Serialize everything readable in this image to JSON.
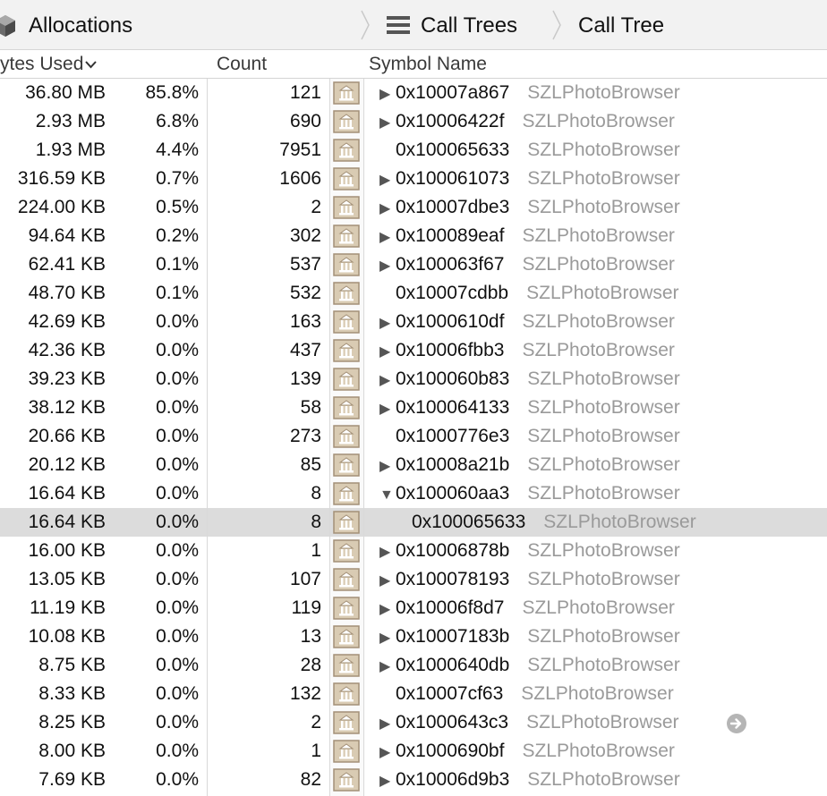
{
  "toolbar": {
    "allocations_label": "Allocations",
    "call_trees_label": "Call Trees",
    "call_tree_label": "Call Tree"
  },
  "columns": {
    "bytes_used": "ytes Used",
    "count": "Count",
    "symbol_name": "Symbol Name"
  },
  "colors": {
    "library_text": "#9a9a9a",
    "selected_row": "#dcdcdc",
    "library_icon_frame": "#a39077",
    "library_icon_fill": "#d9cbb3"
  },
  "rows": [
    {
      "bytes": "36.80 MB",
      "pct": "85.8%",
      "count": "121",
      "disclosure": "collapsed",
      "symbol": "0x10007a867",
      "library": "SZLPhotoBrowser"
    },
    {
      "bytes": "2.93 MB",
      "pct": "6.8%",
      "count": "690",
      "disclosure": "collapsed",
      "symbol": "0x10006422f",
      "library": "SZLPhotoBrowser"
    },
    {
      "bytes": "1.93 MB",
      "pct": "4.4%",
      "count": "7951",
      "disclosure": "none",
      "symbol": "0x100065633",
      "library": "SZLPhotoBrowser"
    },
    {
      "bytes": "316.59 KB",
      "pct": "0.7%",
      "count": "1606",
      "disclosure": "collapsed",
      "symbol": "0x100061073",
      "library": "SZLPhotoBrowser"
    },
    {
      "bytes": "224.00 KB",
      "pct": "0.5%",
      "count": "2",
      "disclosure": "collapsed",
      "symbol": "0x10007dbe3",
      "library": "SZLPhotoBrowser"
    },
    {
      "bytes": "94.64 KB",
      "pct": "0.2%",
      "count": "302",
      "disclosure": "collapsed",
      "symbol": "0x100089eaf",
      "library": "SZLPhotoBrowser"
    },
    {
      "bytes": "62.41 KB",
      "pct": "0.1%",
      "count": "537",
      "disclosure": "collapsed",
      "symbol": "0x100063f67",
      "library": "SZLPhotoBrowser"
    },
    {
      "bytes": "48.70 KB",
      "pct": "0.1%",
      "count": "532",
      "disclosure": "none",
      "symbol": "0x10007cdbb",
      "library": "SZLPhotoBrowser"
    },
    {
      "bytes": "42.69 KB",
      "pct": "0.0%",
      "count": "163",
      "disclosure": "collapsed",
      "symbol": "0x1000610df",
      "library": "SZLPhotoBrowser"
    },
    {
      "bytes": "42.36 KB",
      "pct": "0.0%",
      "count": "437",
      "disclosure": "collapsed",
      "symbol": "0x10006fbb3",
      "library": "SZLPhotoBrowser"
    },
    {
      "bytes": "39.23 KB",
      "pct": "0.0%",
      "count": "139",
      "disclosure": "collapsed",
      "symbol": "0x100060b83",
      "library": "SZLPhotoBrowser"
    },
    {
      "bytes": "38.12 KB",
      "pct": "0.0%",
      "count": "58",
      "disclosure": "collapsed",
      "symbol": "0x100064133",
      "library": "SZLPhotoBrowser"
    },
    {
      "bytes": "20.66 KB",
      "pct": "0.0%",
      "count": "273",
      "disclosure": "none",
      "symbol": "0x1000776e3",
      "library": "SZLPhotoBrowser"
    },
    {
      "bytes": "20.12 KB",
      "pct": "0.0%",
      "count": "85",
      "disclosure": "collapsed",
      "symbol": "0x10008a21b",
      "library": "SZLPhotoBrowser"
    },
    {
      "bytes": "16.64 KB",
      "pct": "0.0%",
      "count": "8",
      "disclosure": "expanded",
      "symbol": "0x100060aa3",
      "library": "SZLPhotoBrowser"
    },
    {
      "bytes": "16.64 KB",
      "pct": "0.0%",
      "count": "8",
      "disclosure": "none",
      "symbol": "0x100065633",
      "library": "SZLPhotoBrowser",
      "selected": true,
      "indent": true
    },
    {
      "bytes": "16.00 KB",
      "pct": "0.0%",
      "count": "1",
      "disclosure": "collapsed",
      "symbol": "0x10006878b",
      "library": "SZLPhotoBrowser"
    },
    {
      "bytes": "13.05 KB",
      "pct": "0.0%",
      "count": "107",
      "disclosure": "collapsed",
      "symbol": "0x100078193",
      "library": "SZLPhotoBrowser"
    },
    {
      "bytes": "11.19 KB",
      "pct": "0.0%",
      "count": "119",
      "disclosure": "collapsed",
      "symbol": "0x10006f8d7",
      "library": "SZLPhotoBrowser"
    },
    {
      "bytes": "10.08 KB",
      "pct": "0.0%",
      "count": "13",
      "disclosure": "collapsed",
      "symbol": "0x10007183b",
      "library": "SZLPhotoBrowser"
    },
    {
      "bytes": "8.75 KB",
      "pct": "0.0%",
      "count": "28",
      "disclosure": "collapsed",
      "symbol": "0x1000640db",
      "library": "SZLPhotoBrowser"
    },
    {
      "bytes": "8.33 KB",
      "pct": "0.0%",
      "count": "132",
      "disclosure": "none",
      "symbol": "0x10007cf63",
      "library": "SZLPhotoBrowser"
    },
    {
      "bytes": "8.25 KB",
      "pct": "0.0%",
      "count": "2",
      "disclosure": "collapsed",
      "symbol": "0x1000643c3",
      "library": "SZLPhotoBrowser",
      "goto_icon": true
    },
    {
      "bytes": "8.00 KB",
      "pct": "0.0%",
      "count": "1",
      "disclosure": "collapsed",
      "symbol": "0x1000690bf",
      "library": "SZLPhotoBrowser"
    },
    {
      "bytes": "7.69 KB",
      "pct": "0.0%",
      "count": "82",
      "disclosure": "collapsed",
      "symbol": "0x10006d9b3",
      "library": "SZLPhotoBrowser"
    }
  ]
}
